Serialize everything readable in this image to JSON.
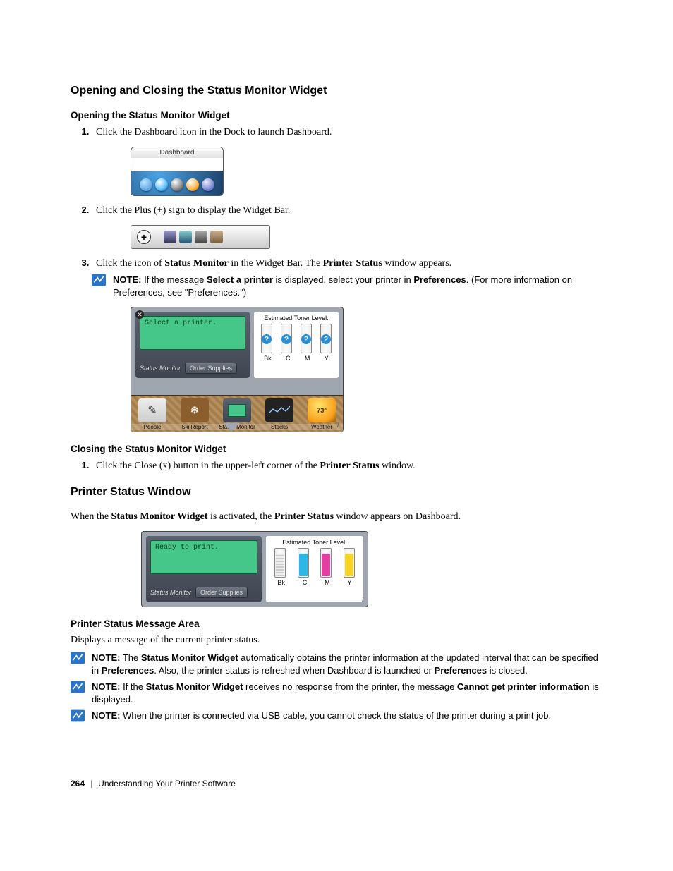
{
  "section": {
    "h2_1": "Opening and Closing the Status Monitor Widget",
    "h3_1": "Opening the Status Monitor Widget",
    "step1": "Click the Dashboard icon in the Dock to launch Dashboard.",
    "step2": "Click the Plus (+) sign to display the Widget Bar.",
    "step3_pre": "Click the icon of ",
    "step3_b1": "Status Monitor",
    "step3_mid": " in the Widget Bar. The ",
    "step3_b2": "Printer Status",
    "step3_post": " window appears.",
    "h3_2": "Closing the Status Monitor Widget",
    "close_step_pre": "Click the Close (x) button in the upper-left corner of the ",
    "close_step_b": "Printer Status",
    "close_step_post": " window.",
    "h2_2": "Printer Status Window",
    "psw_text_1": "When the ",
    "psw_text_b1": "Status Monitor Widget",
    "psw_text_2": " is activated, the ",
    "psw_text_b2": "Printer Status",
    "psw_text_3": " window appears on Dashboard.",
    "h3_3": "Printer Status Message Area",
    "msg_area_text": "Displays a message of the current printer status."
  },
  "fig_dashboard": {
    "tooltip": "Dashboard"
  },
  "fig_widgetbar": {
    "plus": "+"
  },
  "widget1": {
    "screen_text": "Select a printer.",
    "label": "Status Monitor",
    "order_btn": "Order Supplies",
    "toner_caption": "Estimated Toner Level:",
    "q": "?",
    "labels": {
      "bk": "Bk",
      "c": "C",
      "m": "M",
      "y": "Y"
    },
    "shelf": {
      "people": "People",
      "ski": "Ski Report",
      "sm": "Status Monitor",
      "stocks": "Stocks",
      "weather": "Weather",
      "temp": "73°"
    }
  },
  "widget2": {
    "screen_text": "Ready to print.",
    "label": "Status Monitor",
    "order_btn": "Order Supplies",
    "toner_caption": "Estimated Toner Level:",
    "labels": {
      "bk": "Bk",
      "c": "C",
      "m": "M",
      "y": "Y"
    }
  },
  "notes": {
    "label": "NOTE:",
    "n1_a": " If the message ",
    "n1_b1": "Select a printer",
    "n1_b": " is displayed, select your printer in ",
    "n1_b2": "Preferences",
    "n1_c": ". (For more information on Preferences, see \"Preferences.\")",
    "n2_a": " The ",
    "n2_b1": "Status Monitor Widget",
    "n2_b": " automatically obtains the printer information at the updated interval that can be specified in ",
    "n2_b2": "Preferences",
    "n2_c": ". Also, the printer status is refreshed when Dashboard is launched or ",
    "n2_b3": "Preferences",
    "n2_d": " is closed.",
    "n3_a": " If the ",
    "n3_b1": "Status Monitor Widget",
    "n3_b": " receives no response from the printer, the message ",
    "n3_b2": "Cannot get printer information",
    "n3_c": " is displayed.",
    "n4": " When the printer is connected via USB cable, you cannot check the status of the printer during a print job."
  },
  "footer": {
    "page": "264",
    "chapter": "Understanding Your Printer Software"
  }
}
